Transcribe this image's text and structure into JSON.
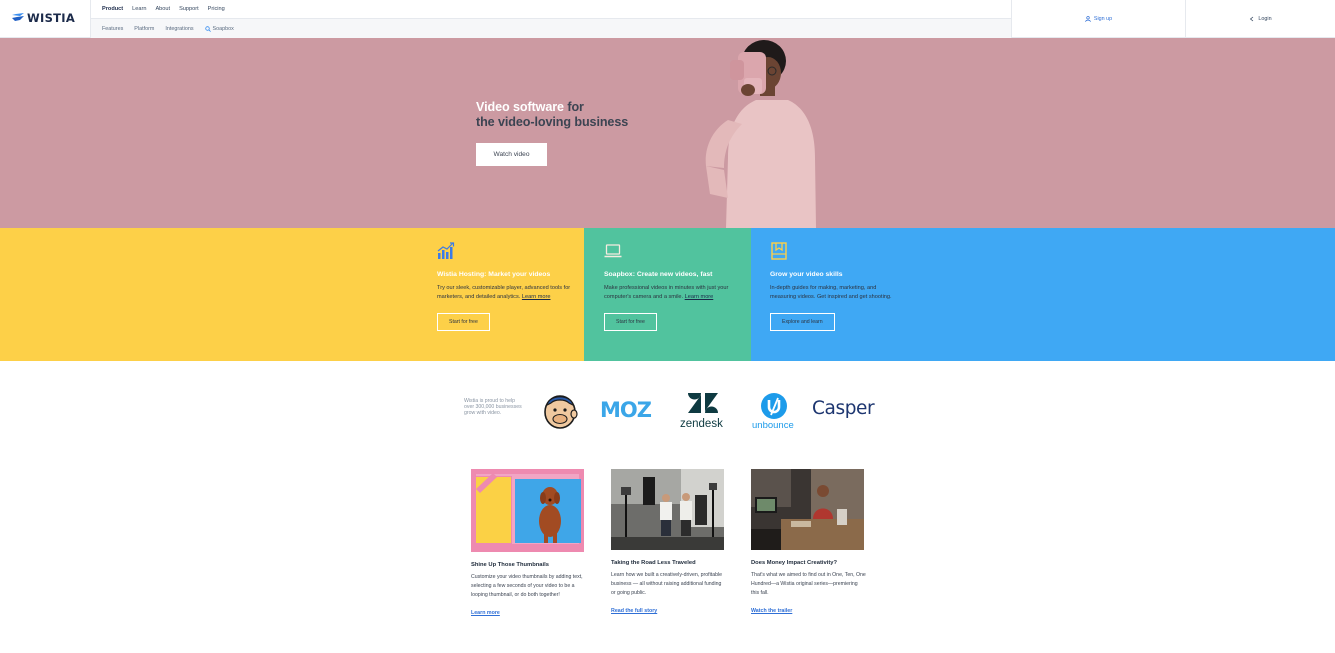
{
  "header": {
    "brand": "WISTIA",
    "primary_nav": [
      "Product",
      "Learn",
      "About",
      "Support",
      "Pricing"
    ],
    "secondary_nav": [
      "Features",
      "Platform",
      "Integrations",
      "Soapbox"
    ],
    "signup": "Sign up",
    "login": "Login"
  },
  "hero": {
    "title_highlight": "Video software",
    "title_rest_1": " for",
    "title_rest_2": "the video-loving business",
    "button": "Watch video",
    "background": "#cc9aa2"
  },
  "features": [
    {
      "title": "Wistia Hosting: Market your videos",
      "body": "Try our sleek, customizable player, advanced tools for marketers, and detailed analytics.",
      "link": "Learn more",
      "button": "Start for free",
      "color": "#fdd048",
      "icon": "chart-icon"
    },
    {
      "title": "Soapbox: Create new videos, fast",
      "body": "Make professional videos in minutes with just your computer's camera and a smile.",
      "link": "Learn more",
      "button": "Start for free",
      "color": "#51c39e",
      "icon": "laptop-icon"
    },
    {
      "title": "Grow your video skills",
      "body": "In-depth guides for making, marketing, and measuring videos. Get inspired and get shooting.",
      "button": "Explore and learn",
      "color": "#3fa8f4",
      "icon": "book-icon"
    }
  ],
  "customers": {
    "blurb": "Wistia is proud to help over 300,000 businesses grow with video.",
    "logos": [
      "Mailchimp",
      "MOZ",
      "zendesk",
      "unbounce",
      "Casper"
    ]
  },
  "stories": [
    {
      "title": "Shine Up Those Thumbnails",
      "desc": "Customize your video thumbnails by adding text, selecting a few seconds of your video to be a looping thumbnail, or do both together!",
      "link": "Learn more"
    },
    {
      "title": "Taking the Road Less Traveled",
      "desc": "Learn how we built a creatively-driven, profitable business — all without raising additional funding or going public.",
      "link": "Read the full story"
    },
    {
      "title": "Does Money Impact Creativity?",
      "desc": "That's what we aimed to find out in One, Ten, One Hundred—a Wistia original series—premiering this fall.",
      "link": "Watch the trailer"
    }
  ]
}
